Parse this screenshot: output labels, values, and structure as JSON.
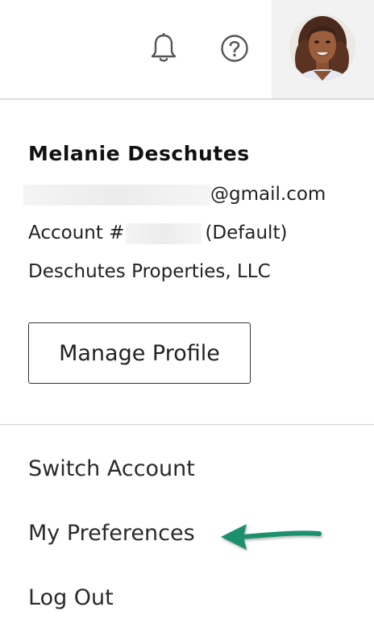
{
  "header": {
    "icons": {
      "bell": "bell-icon",
      "help": "question-circle-icon"
    },
    "avatar": "user-avatar"
  },
  "profile": {
    "name": "Melanie Deschutes",
    "email_suffix": "@gmail.com",
    "account_prefix": "Account #",
    "account_suffix": "(Default)",
    "company": "Deschutes Properties, LLC",
    "manage_button": "Manage Profile"
  },
  "menu": {
    "items": [
      {
        "label": "Switch Account"
      },
      {
        "label": "My Preferences"
      },
      {
        "label": "Log Out"
      }
    ]
  },
  "colors": {
    "arrow": "#1e8f6c",
    "avatar_tab_bg": "#f2f2f2",
    "divider": "#cfcfcf"
  }
}
